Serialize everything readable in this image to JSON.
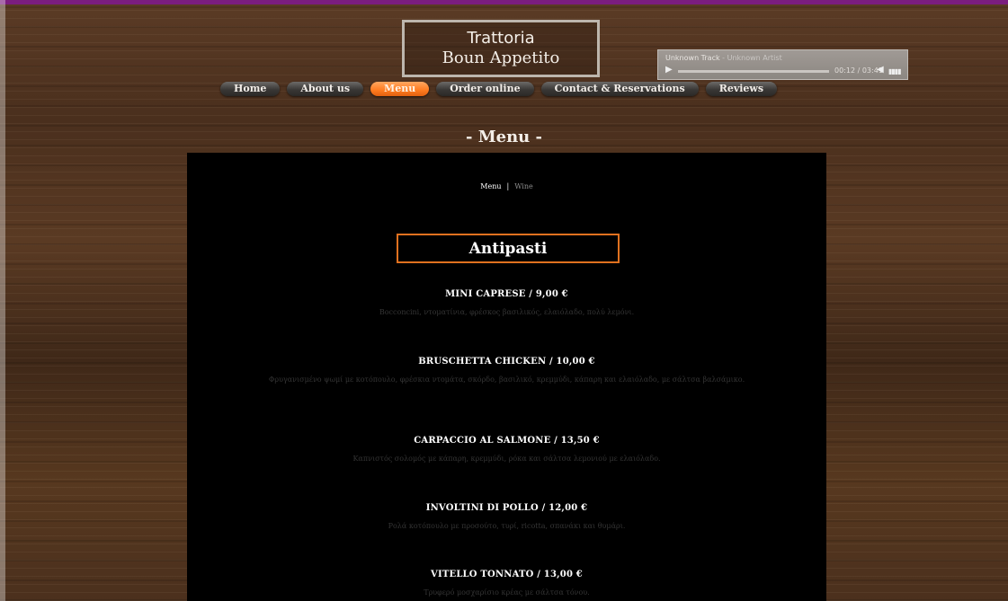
{
  "site": {
    "logo_line1": "Trattoria",
    "logo_line2": "Boun Appetito"
  },
  "player": {
    "track": "Unknown Track",
    "artist": " - Unknown Artist",
    "time": "00:12 / 03:41"
  },
  "nav": {
    "items": [
      {
        "label": "Home"
      },
      {
        "label": "About us"
      },
      {
        "label": "Menu"
      },
      {
        "label": "Order online"
      },
      {
        "label": "Contact & Reservations"
      },
      {
        "label": "Reviews"
      }
    ]
  },
  "page": {
    "section_title": "- Menu -"
  },
  "submenu": {
    "menu": "Menu",
    "separator": "|",
    "wine": "Wine"
  },
  "category": {
    "title": "Antipasti"
  },
  "dishes": [
    {
      "name": "MINI CAPRESE  /  9,00 €",
      "desc": "Bocconcini, ντοματίνια, φρέσκος βασιλικός, ελαιόλαδο, πολύ λεμόνι."
    },
    {
      "name": "BRUSCHETTA CHICKEN  /  10,00 €",
      "desc": "Φρυγανισμένο ψωμί με κοτόπουλο, φρέσκια ντομάτα, σκόρδο, βασιλικό, κρεμμύδι, κάπαρη και ελαιόλαδο, με σάλτσα βαλσάμικο."
    },
    {
      "name": "CARPACCIO AL SALMONE  /  13,50 €",
      "desc": "Καπνιστός σολομός με κάπαρη, κρεμμύδι, ρόκα και σάλτσα λεμονιού με ελαιόλαδο."
    },
    {
      "name": "INVOLTINI DI POLLO  /  12,00 €",
      "desc": "Ρολά κοτόπουλο με προσούτο, τυρί, ricotta, σπανάκι και θυμάρι."
    },
    {
      "name": "VITELLO TONNATO  /  13,00 €",
      "desc": "Τρυφερό μοσχαρίσιο κρέας με σάλτσα τόνου."
    }
  ],
  "colors": {
    "accent": "#ff7b1f",
    "top_border": "#7b1d7f",
    "panel_bg": "#000000"
  }
}
